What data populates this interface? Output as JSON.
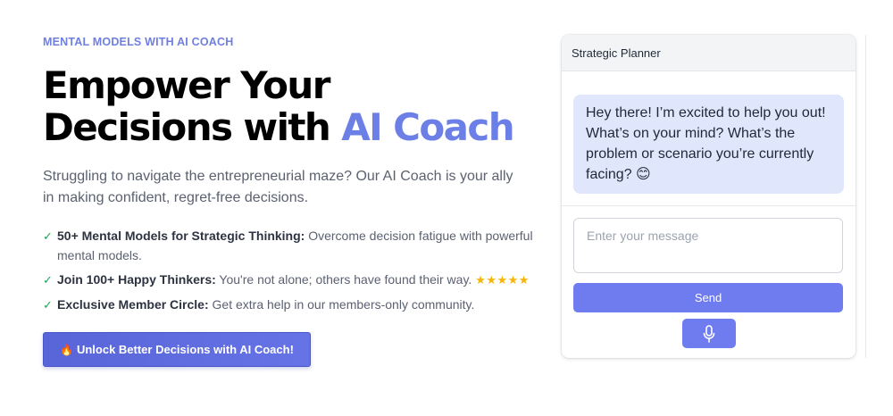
{
  "hero": {
    "eyebrow": "MENTAL MODELS WITH AI COACH",
    "headline_line1": "Empower Your",
    "headline_line2_prefix": "Decisions with ",
    "headline_accent": "AI Coach",
    "subtitle": "Struggling to navigate the entrepreneurial maze? Our AI Coach is your ally in making confident, regret-free decisions.",
    "features": [
      {
        "check": "✓",
        "title": "50+ Mental Models for Strategic Thinking:",
        "text": " Overcome decision fatigue with powerful mental models."
      },
      {
        "check": "✓",
        "title": "Join 100+ Happy Thinkers:",
        "text": " You're not alone; others have found their way. ",
        "stars": "★★★★★"
      },
      {
        "check": "✓",
        "title": "Exclusive Member Circle:",
        "text": " Get extra help in our members-only community."
      }
    ],
    "cta_icon": "🔥",
    "cta_label": "Unlock Better Decisions with AI Coach!"
  },
  "chat": {
    "title": "Strategic Planner",
    "message": "Hey there! I’m excited to help you out! What’s on your mind? What’s the problem or scenario you’re currently facing? 😊",
    "input_value": "",
    "input_placeholder": "Enter your message",
    "send_label": "Send",
    "mic_icon": "microphone-icon"
  },
  "colors": {
    "accent": "#6c7fe6",
    "eyebrow": "#6f7fe0",
    "button": "#6e7cf0",
    "bubble": "#e0e6fb",
    "check": "#22a55a",
    "stars": "#f5b50a"
  }
}
